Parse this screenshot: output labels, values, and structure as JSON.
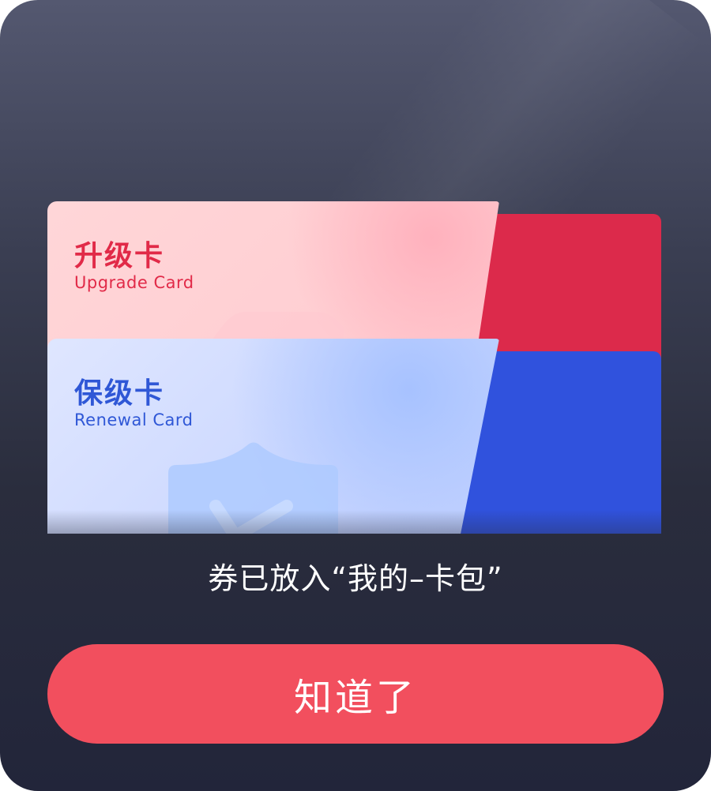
{
  "cards": {
    "upgrade": {
      "title_cn": "升级卡",
      "title_en": "Upgrade Card",
      "emblem": "upgrade-arrow-icon"
    },
    "renewal": {
      "title_cn": "保级卡",
      "title_en": "Renewal Card",
      "emblem": "shield-check-icon"
    }
  },
  "message": "券已放入“我的–卡包”",
  "button": {
    "label": "知道了"
  },
  "colors": {
    "modal_bg": "#2a2d3d",
    "upgrade_accent": "#dc2a4b",
    "renewal_accent": "#3052dd",
    "button_bg": "#f24f5e",
    "text_on_dark": "#ffffff"
  }
}
